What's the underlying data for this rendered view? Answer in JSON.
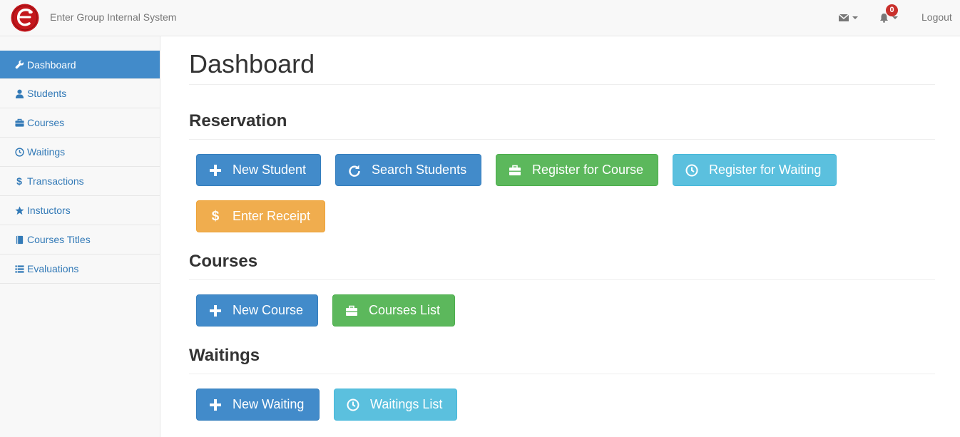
{
  "navbar": {
    "brand": "Enter Group Internal System",
    "notification_count": "0",
    "logout_label": "Logout"
  },
  "sidebar": {
    "items": [
      {
        "label": "Dashboard",
        "icon": "wrench-icon",
        "active": true
      },
      {
        "label": "Students",
        "icon": "user-icon"
      },
      {
        "label": "Courses",
        "icon": "briefcase-icon"
      },
      {
        "label": "Waitings",
        "icon": "clock-icon"
      },
      {
        "label": "Transactions",
        "icon": "dollar-icon"
      },
      {
        "label": "Instuctors",
        "icon": "star-icon"
      },
      {
        "label": "Courses Titles",
        "icon": "book-icon"
      },
      {
        "label": "Evaluations",
        "icon": "list-icon"
      }
    ]
  },
  "main": {
    "title": "Dashboard",
    "reservation": {
      "heading": "Reservation",
      "new_student": "New Student",
      "search_students": "Search Students",
      "register_course": "Register for Course",
      "register_waiting": "Register for Waiting",
      "enter_receipt": "Enter Receipt"
    },
    "courses": {
      "heading": "Courses",
      "new_course": "New Course",
      "courses_list": "Courses List"
    },
    "waitings": {
      "heading": "Waitings",
      "new_waiting": "New Waiting",
      "waitings_list": "Waitings List"
    }
  },
  "colors": {
    "primary": "#428bca",
    "success": "#5cb85c",
    "info": "#5bc0de",
    "warning": "#f0ad4e",
    "logo_red": "#c4161c"
  }
}
